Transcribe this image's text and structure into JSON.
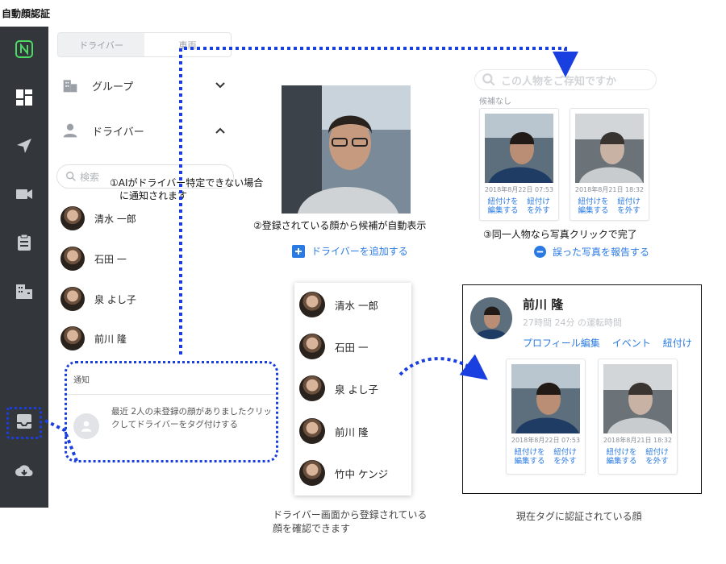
{
  "page_title": "自動顔認証",
  "sidebar": {
    "segment": {
      "left": "ドライバー",
      "right": "車両"
    },
    "sections": [
      {
        "label": "グループ",
        "icon": "building-icon",
        "expanded": false
      },
      {
        "label": "ドライバー",
        "icon": "person-icon",
        "expanded": true
      }
    ],
    "search_placeholder": "検索",
    "drivers": [
      "清水 一郎",
      "石田 一",
      "泉 よし子",
      "前川 隆"
    ]
  },
  "rail_icons": [
    "logo-icon",
    "dashboard-icon",
    "navigation-icon",
    "video-icon",
    "clipboard-icon",
    "building-icon",
    "inbox-icon",
    "cloud-download-icon"
  ],
  "notification": {
    "heading": "通知",
    "message": "最近 2人の未登録の顔がありましたクリックしてドライバーをタグ付けする"
  },
  "annotations": {
    "step1_line1": "①AIがドライバー特定できない場合",
    "step1_line2": "に通知されます",
    "step2": "②登録されている顔から候補が自動表示",
    "step3": "③同一人物なら写真クリックで完了",
    "caption_left_line1": "ドライバー画面から登録されている",
    "caption_left_line2": "顔を確認できます",
    "caption_right": "現在タグに認証されている顔"
  },
  "center": {
    "add_driver": "ドライバーを追加する"
  },
  "candidates": {
    "search_placeholder": "この人物をご存知ですか",
    "none_label": "候補なし",
    "report_link": "誤った写真を報告する",
    "cards": [
      {
        "date": "2018年8月22日 07:53",
        "action1": "紐付けを編集する",
        "action2": "紐付けを外す"
      },
      {
        "date": "2018年8月21日 18:32",
        "action1": "紐付けを編集する",
        "action2": "紐付けを外す"
      }
    ]
  },
  "popup_drivers": [
    "清水 一郎",
    "石田 一",
    "泉 よし子",
    "前川 隆",
    "竹中 ケンジ"
  ],
  "profile": {
    "name": "前川 隆",
    "drive_time": "27時間 24分 の運転時間",
    "links": [
      "プロフィール編集",
      "イベント",
      "紐付け"
    ],
    "cards": [
      {
        "date": "2018年8月22日 07:53",
        "action1": "紐付けを編集する",
        "action2": "紐付けを外す"
      },
      {
        "date": "2018年8月21日 18:32",
        "action1": "紐付けを編集する",
        "action2": "紐付けを外す"
      }
    ]
  },
  "colors": {
    "rail_bg": "#33373c",
    "accent_blue": "#2a7ae2",
    "dotted_blue": "#1a3fe0",
    "logo_green": "#4cd964"
  }
}
